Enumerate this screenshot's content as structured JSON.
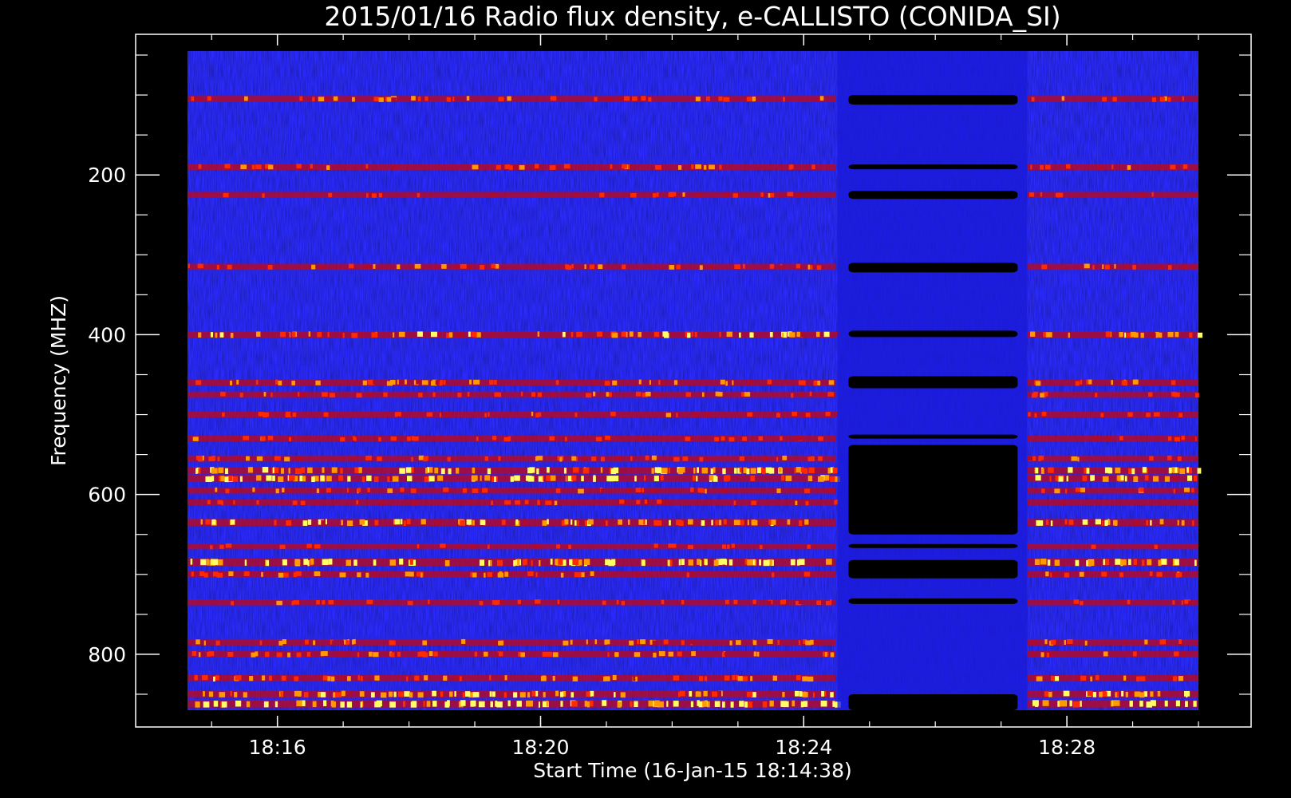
{
  "chart_data": {
    "type": "heatmap",
    "title": "2015/01/16  Radio flux density, e-CALLISTO (CONIDA_SI)",
    "xlabel": "Start Time (16-Jan-15 18:14:38)",
    "ylabel": "Frequency (MHZ)",
    "x_unit": "time",
    "xlim": [
      "18:14:38",
      "18:30:00"
    ],
    "ylim": [
      45,
      870
    ],
    "y_inverted": true,
    "x_ticks": [
      {
        "value": "18:16",
        "label": "18:16"
      },
      {
        "value": "18:20",
        "label": "18:20"
      },
      {
        "value": "18:24",
        "label": "18:24"
      },
      {
        "value": "18:28",
        "label": "18:28"
      }
    ],
    "y_ticks": [
      {
        "value": 200,
        "label": "200"
      },
      {
        "value": 400,
        "label": "400"
      },
      {
        "value": 600,
        "label": "600"
      },
      {
        "value": 800,
        "label": "800"
      }
    ],
    "colormap": [
      "#000000",
      "#1a1ad8",
      "#2b2bff",
      "#b00a2a",
      "#ff2a00",
      "#ff9900",
      "#ffff66"
    ],
    "background_color": "#000000",
    "gap_interval": {
      "start": "18:24:38",
      "end": "18:27:18"
    },
    "bands": [
      {
        "freq": 105,
        "intensity": 0.55
      },
      {
        "freq": 190,
        "intensity": 0.55
      },
      {
        "freq": 225,
        "intensity": 0.5
      },
      {
        "freq": 315,
        "intensity": 0.55
      },
      {
        "freq": 400,
        "intensity": 0.7
      },
      {
        "freq": 460,
        "intensity": 0.6
      },
      {
        "freq": 475,
        "intensity": 0.55
      },
      {
        "freq": 500,
        "intensity": 0.5
      },
      {
        "freq": 530,
        "intensity": 0.5
      },
      {
        "freq": 555,
        "intensity": 0.55
      },
      {
        "freq": 570,
        "intensity": 0.85
      },
      {
        "freq": 580,
        "intensity": 0.8
      },
      {
        "freq": 595,
        "intensity": 0.55
      },
      {
        "freq": 610,
        "intensity": 0.5
      },
      {
        "freq": 635,
        "intensity": 0.75
      },
      {
        "freq": 665,
        "intensity": 0.45
      },
      {
        "freq": 685,
        "intensity": 0.9
      },
      {
        "freq": 700,
        "intensity": 0.6
      },
      {
        "freq": 735,
        "intensity": 0.5
      },
      {
        "freq": 785,
        "intensity": 0.6
      },
      {
        "freq": 800,
        "intensity": 0.6
      },
      {
        "freq": 830,
        "intensity": 0.65
      },
      {
        "freq": 850,
        "intensity": 0.75
      },
      {
        "freq": 862,
        "intensity": 0.9
      }
    ],
    "gap_blocks": [
      {
        "freq_start": 100,
        "freq_end": 112
      },
      {
        "freq_start": 187,
        "freq_end": 193
      },
      {
        "freq_start": 220,
        "freq_end": 230
      },
      {
        "freq_start": 310,
        "freq_end": 322
      },
      {
        "freq_start": 395,
        "freq_end": 403
      },
      {
        "freq_start": 452,
        "freq_end": 467
      },
      {
        "freq_start": 525,
        "freq_end": 530
      },
      {
        "freq_start": 538,
        "freq_end": 650
      },
      {
        "freq_start": 662,
        "freq_end": 667
      },
      {
        "freq_start": 682,
        "freq_end": 705
      },
      {
        "freq_start": 730,
        "freq_end": 737
      },
      {
        "freq_start": 850,
        "freq_end": 870
      }
    ]
  }
}
